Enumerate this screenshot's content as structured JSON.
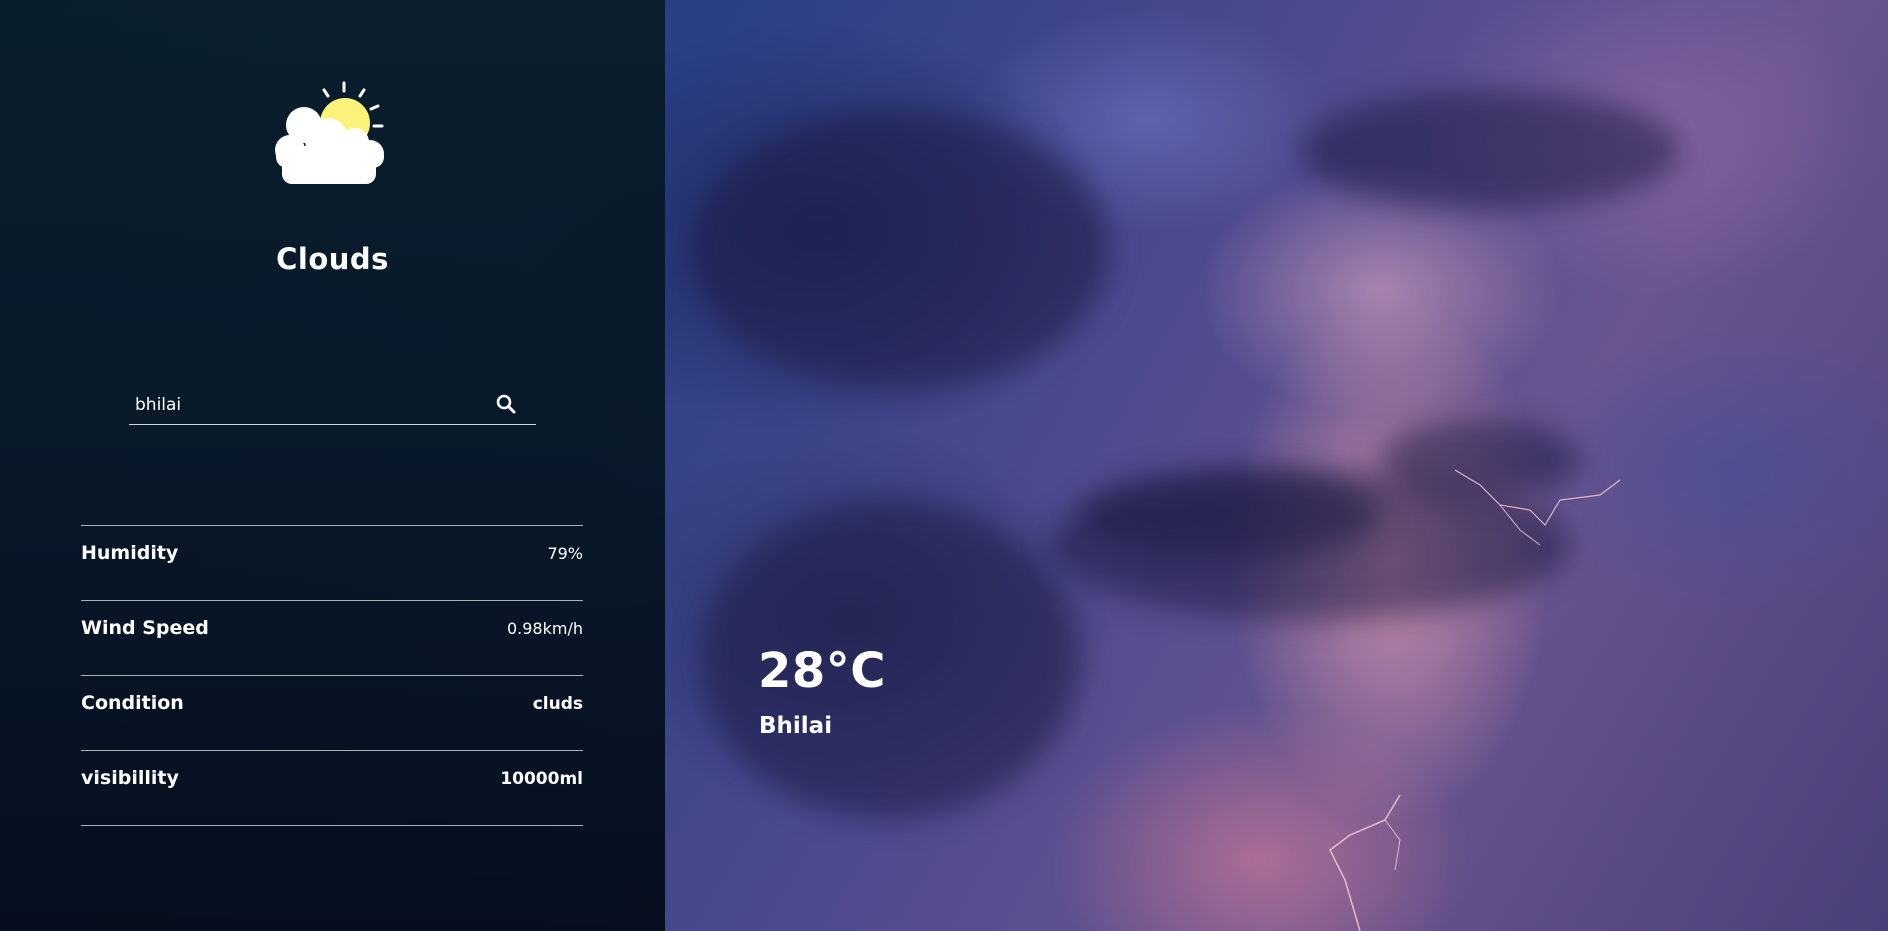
{
  "weather": {
    "icon": "sun-behind-cloud-icon",
    "condition": "Clouds"
  },
  "search": {
    "value": "bhilai",
    "icon": "search-icon"
  },
  "details": [
    {
      "label": "Humidity",
      "value": "79%"
    },
    {
      "label": "Wind Speed",
      "value": "0.98km/h"
    },
    {
      "label": "Condition",
      "value": "cluds"
    },
    {
      "label": "visibillity",
      "value": "10000ml"
    }
  ],
  "current": {
    "temperature": "28°C",
    "city": "Bhilai"
  },
  "colors": {
    "panel": "#06182a",
    "sun": "#fbf27a",
    "cloud": "#ffffff"
  }
}
